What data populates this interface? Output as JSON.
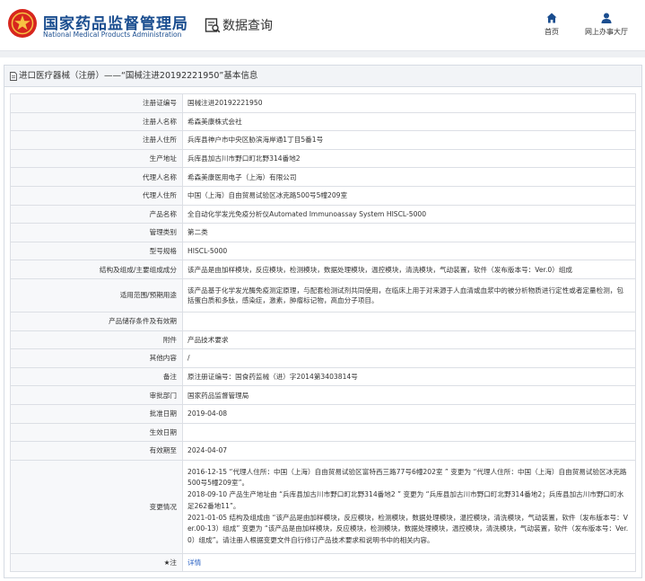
{
  "header": {
    "brand_cn": "国家药品监督管理局",
    "brand_en": "National Medical Products Administration",
    "section_title": "数据查询",
    "nav_home": "首页",
    "nav_user": "网上办事大厅",
    "brand_color": "#1a4d8f",
    "logo_color": "#d7261e"
  },
  "panel": {
    "title": "进口医疗器械（注册）——“国械注进20192221950”基本信息"
  },
  "table": {
    "rows": [
      {
        "label": "注册证编号",
        "value": "国械注进20192221950"
      },
      {
        "label": "注册人名称",
        "value": "希森美康株式会社"
      },
      {
        "label": "注册人住所",
        "value": "兵库县神户市中央区胁滨海岸通1丁目5番1号"
      },
      {
        "label": "生产地址",
        "value": "兵库县加古川市野口町北野314番地2"
      },
      {
        "label": "代理人名称",
        "value": "希森美康医用电子（上海）有限公司"
      },
      {
        "label": "代理人住所",
        "value": "中国（上海）自由贸易试验区冰克路500号5幢209室"
      },
      {
        "label": "产品名称",
        "value": "全自动化学发光免疫分析仪Automated Immunoassay System HISCL-5000"
      },
      {
        "label": "管理类别",
        "value": "第二类"
      },
      {
        "label": "型号规格",
        "value": "HISCL-5000"
      },
      {
        "label": "结构及组成/主要组成成分",
        "value": "该产品是由加样模块，反应模块，检测模块，数据处理模块，温控模块，清洗模块，气动装置，软件（发布版本号：Ver.0）组成"
      },
      {
        "label": "适用范围/预期用途",
        "value": "该产品基于化学发光酶免疫测定原理，与配套检测试剂共同使用，在临床上用于对来源于人血清或血浆中的被分析物质进行定性或者定量检测，包括蛋白质和多肽，感染症，激素，肿瘤标记物，高血分子项目。"
      },
      {
        "label": "产品储存条件及有效期",
        "value": ""
      },
      {
        "label": "附件",
        "value": "产品技术要求"
      },
      {
        "label": "其他内容",
        "value": "/"
      },
      {
        "label": "备注",
        "value": "原注册证编号：国食药监械（进）字2014第3403814号"
      },
      {
        "label": "审批部门",
        "value": "国家药品监督管理局"
      },
      {
        "label": "批准日期",
        "value": "2019-04-08"
      },
      {
        "label": "生效日期",
        "value": ""
      },
      {
        "label": "有效期至",
        "value": "2024-04-07"
      }
    ],
    "change_label": "变更情况",
    "changes": [
      "2016-12-15 “代理人住所：中国（上海）自由贸易试验区富特西三路77号6幢202室 ” 变更为 “代理人住所：中国（上海）自由贸易试验区冰克路500号5幢209室”。",
      "2018-09-10 产品生产地址由 “兵库县加古川市野口町北野314番地2 ” 变更为 “兵库县加古川市野口町北野314番地2；兵库县加古川市野口町水足262番地11”。",
      "2021-01-05 结构及组成由 “该产品是由加样模块，反应模块，检测模块，数据处理模块，温控模块，清洗模块，气动装置，软件（发布版本号：Ver.00-13）组成” 变更为 “该产品是由加样模块，反应模块，检测模块，数据处理模块，温控模块，清洗模块，气动装置，软件（发布版本号：Ver.0）组成”。请注册人根据变更文件自行修订产品技术要求和说明书中的相关内容。"
    ],
    "note_label": "★注",
    "note_link": "详情"
  }
}
